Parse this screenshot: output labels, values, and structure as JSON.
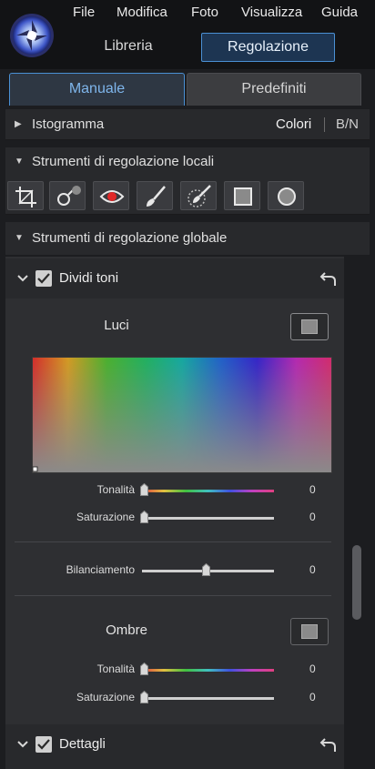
{
  "menu": {
    "items": [
      "File",
      "Modifica",
      "Foto",
      "Visualizza",
      "Guida"
    ]
  },
  "modes": {
    "libreria": "Libreria",
    "regolazione": "Regolazione"
  },
  "tabs": {
    "manuale": "Manuale",
    "predefiniti": "Predefiniti"
  },
  "rows": {
    "istogramma": "Istogramma",
    "colori": "Colori",
    "bn": "B/N",
    "local_tools": "Strumenti di regolazione locali",
    "global_tools": "Strumenti di regolazione globale"
  },
  "tools": [
    "crop-icon",
    "adjustment-tool-icon",
    "red-eye-icon",
    "brush-icon",
    "spot-removal-icon",
    "square-mask-icon",
    "radial-mask-icon"
  ],
  "split_toning": {
    "title": "Dividi toni",
    "checked": true,
    "highlights": {
      "label": "Luci",
      "hue_label": "Tonalità",
      "hue_value": "0",
      "sat_label": "Saturazione",
      "sat_value": "0"
    },
    "balance_label": "Bilanciamento",
    "balance_value": "0",
    "shadows": {
      "label": "Ombre",
      "hue_label": "Tonalità",
      "hue_value": "0",
      "sat_label": "Saturazione",
      "sat_value": "0"
    }
  },
  "details": {
    "title": "Dettagli",
    "checked": true
  },
  "colors": {
    "accent": "#4a90d4",
    "panel": "#2e2f32"
  }
}
